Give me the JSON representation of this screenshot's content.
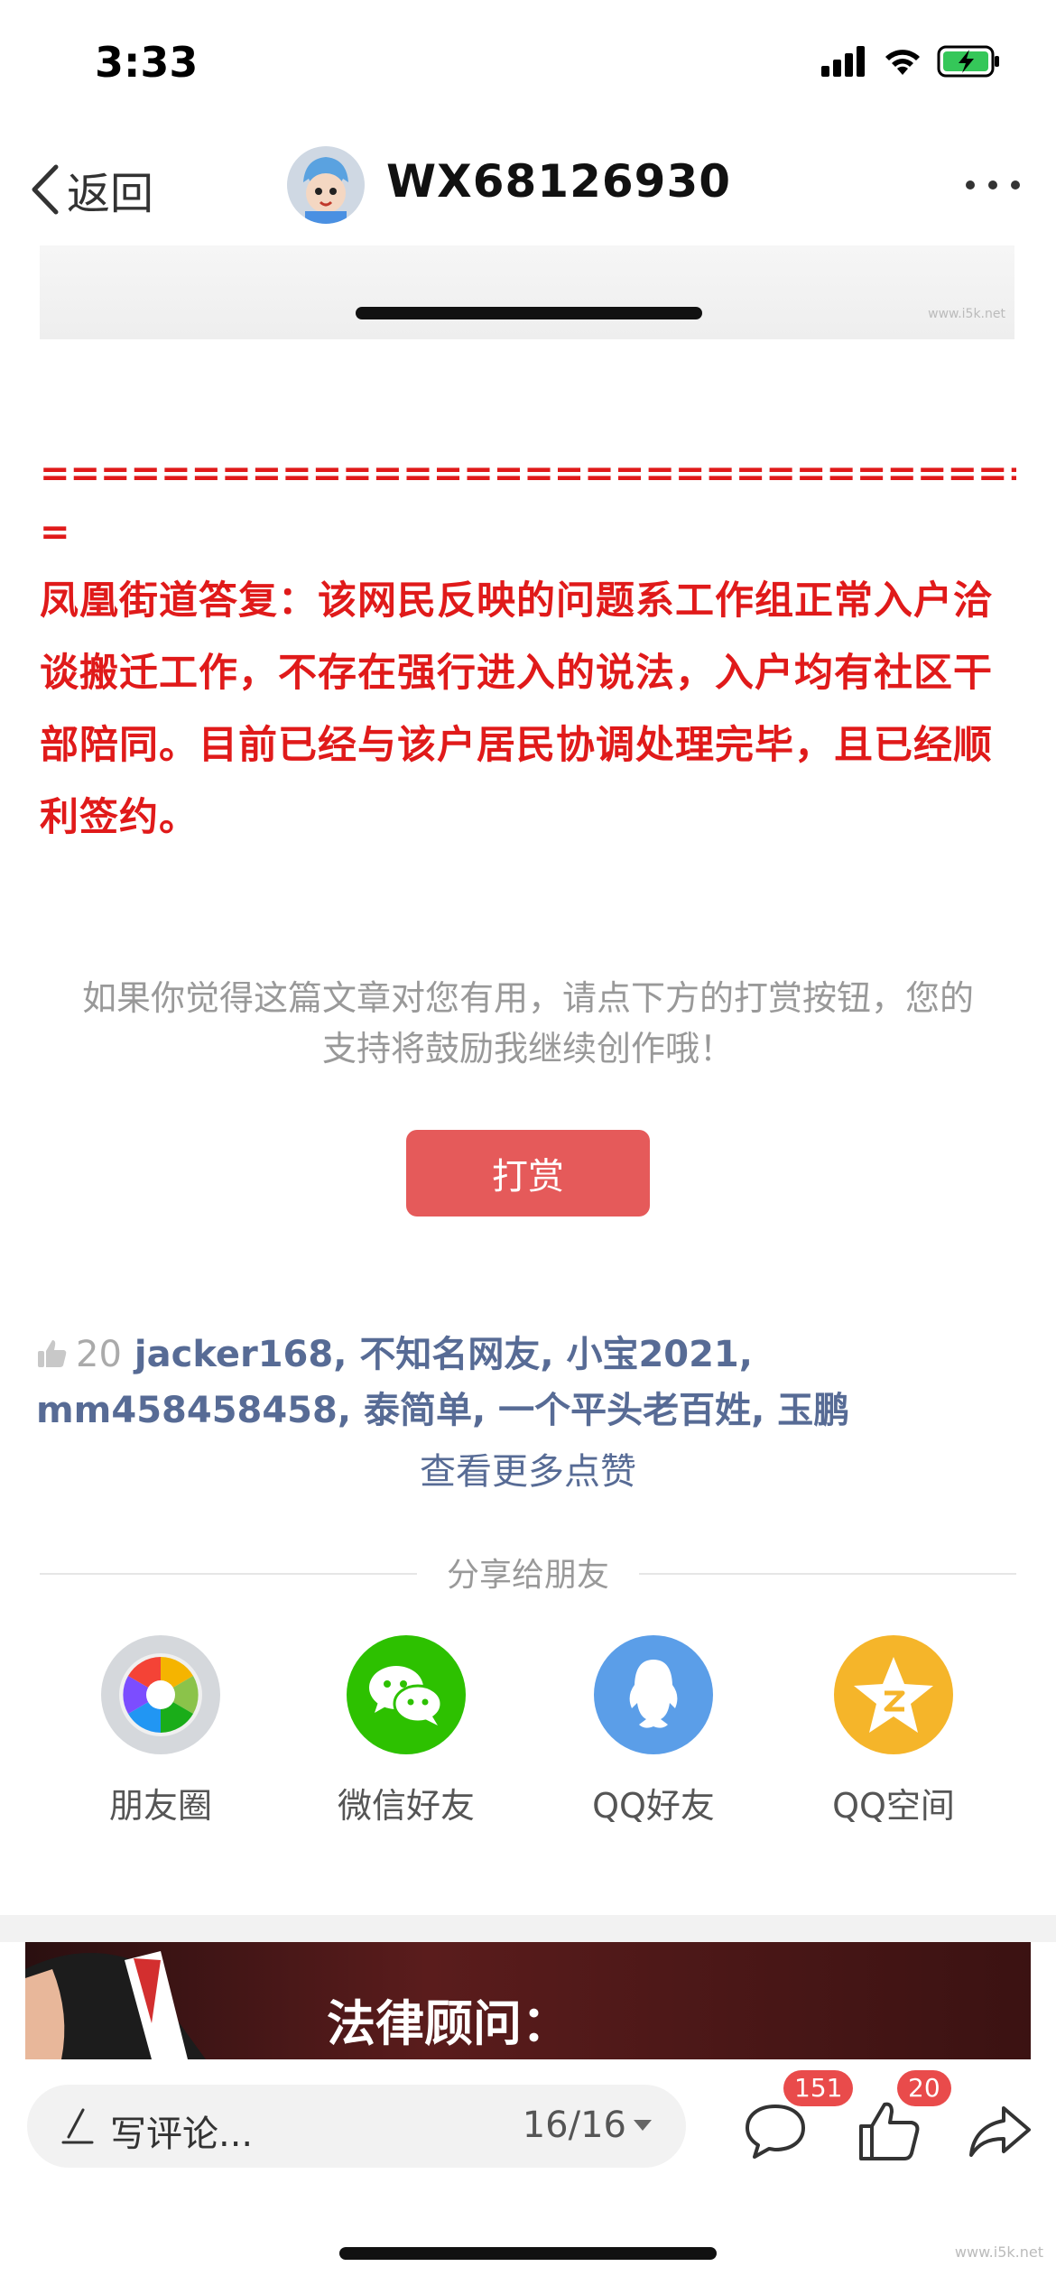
{
  "status_bar": {
    "time": "3:33"
  },
  "nav": {
    "back_label": "返回",
    "title": "WX68126930"
  },
  "watermark": "www.i5k.net",
  "article": {
    "separator_line1": "=========================================",
    "separator_line2": "=",
    "reply": "凤凰街道答复：该网民反映的问题系工作组正常入户洽谈搬迁工作，不存在强行进入的说法，入户均有社区干部陪同。目前已经与该户居民协调处理完毕，且已经顺利签约。",
    "text_color": "#e01a1a"
  },
  "reward": {
    "hint": "如果你觉得这篇文章对您有用，请点下方的打赏按钮，您的支持将鼓励我继续创作哦！",
    "button_label": "打赏",
    "button_color": "#e55a5a"
  },
  "likes": {
    "count": "20",
    "names": "jacker168, 不知名网友, 小宝2021, mm458458458, 泰简单, 一个平头老百姓, 玉鹏",
    "more_label": "查看更多点赞",
    "link_color": "#576b95"
  },
  "share": {
    "title": "分享给朋友",
    "items": [
      {
        "label": "朋友圈",
        "icon": "moments-icon"
      },
      {
        "label": "微信好友",
        "icon": "wechat-icon"
      },
      {
        "label": "QQ好友",
        "icon": "qq-icon"
      },
      {
        "label": "QQ空间",
        "icon": "qzone-icon"
      }
    ]
  },
  "banner": {
    "text": "法律顾问："
  },
  "toolbar": {
    "comment_placeholder": "写评论...",
    "page_indicator": "16/16",
    "comment_count": "151",
    "like_count": "20"
  }
}
